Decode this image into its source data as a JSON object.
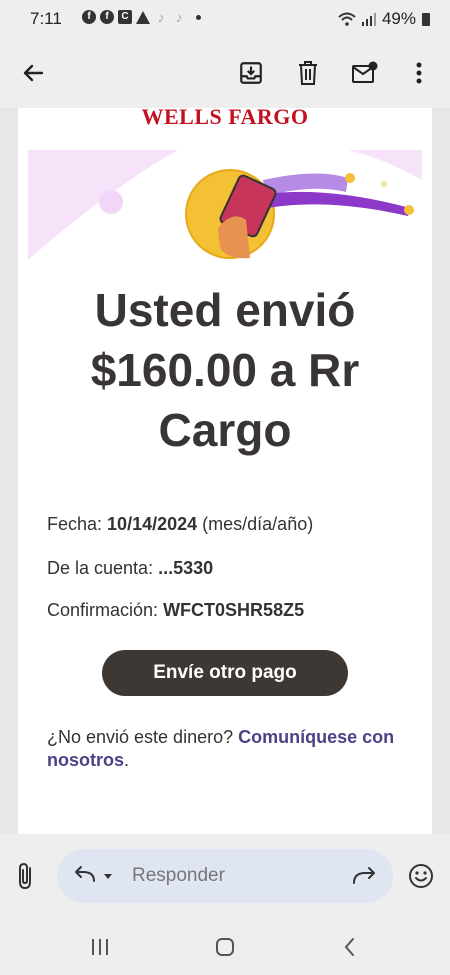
{
  "status": {
    "time": "7:11",
    "notif_icons": [
      "facebook-icon",
      "facebook-icon",
      "c-app-icon",
      "warning-icon",
      "tiktok-icon",
      "tiktok-icon"
    ],
    "battery": "49%"
  },
  "email": {
    "brand": "WELLS FARGO",
    "headline_line1": "Usted envió",
    "headline_line2": "$160.00 a Rr",
    "headline_line3": "Cargo",
    "date_label": "Fecha:",
    "date_value": "10/14/2024",
    "date_format": "(mes/día/año)",
    "account_label": "De la cuenta:",
    "account_value": "...5330",
    "confirmation_label": "Confirmación:",
    "confirmation_value": "WFCT0SHR58Z5",
    "button_label": "Envíe otro pago",
    "contact_text": "¿No envió este dinero?",
    "contact_link": "Comuníquese con nosotros",
    "contact_end": "."
  },
  "reply": {
    "placeholder": "Responder"
  },
  "colors": {
    "brand_red": "#c1121f",
    "button_dark": "#3e3835",
    "link_purple": "#4e4185",
    "reply_pill": "#dfe6f1"
  }
}
